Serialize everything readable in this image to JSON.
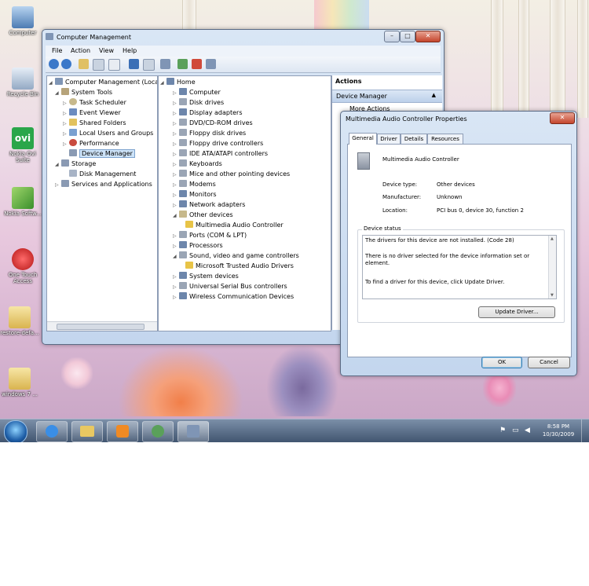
{
  "desktop": {
    "icons": [
      {
        "label": "Computer"
      },
      {
        "label": "Recycle Bin"
      },
      {
        "label": "Nokia Ovi Suite"
      },
      {
        "label": "Nokia Softw..."
      },
      {
        "label": "One Touch Access"
      },
      {
        "label": "restore-defa..."
      },
      {
        "label": "windows 7 ..."
      }
    ],
    "ovi_logo_text": "ovi"
  },
  "mgmt_window": {
    "title": "Computer Management",
    "menu": [
      "File",
      "Action",
      "View",
      "Help"
    ],
    "tree": [
      {
        "label": "Computer Management (Local"
      },
      {
        "label": "System Tools"
      },
      {
        "label": "Task Scheduler"
      },
      {
        "label": "Event Viewer"
      },
      {
        "label": "Shared Folders"
      },
      {
        "label": "Local Users and Groups"
      },
      {
        "label": "Performance"
      },
      {
        "label": "Device Manager"
      },
      {
        "label": "Storage"
      },
      {
        "label": "Disk Management"
      },
      {
        "label": "Services and Applications"
      }
    ],
    "devices": [
      {
        "label": "Home"
      },
      {
        "label": "Computer"
      },
      {
        "label": "Disk drives"
      },
      {
        "label": "Display adapters"
      },
      {
        "label": "DVD/CD-ROM drives"
      },
      {
        "label": "Floppy disk drives"
      },
      {
        "label": "Floppy drive controllers"
      },
      {
        "label": "IDE ATA/ATAPI controllers"
      },
      {
        "label": "Keyboards"
      },
      {
        "label": "Mice and other pointing devices"
      },
      {
        "label": "Modems"
      },
      {
        "label": "Monitors"
      },
      {
        "label": "Network adapters"
      },
      {
        "label": "Other devices"
      },
      {
        "label": "Multimedia Audio Controller"
      },
      {
        "label": "Ports (COM & LPT)"
      },
      {
        "label": "Processors"
      },
      {
        "label": "Sound, video and game controllers"
      },
      {
        "label": "Microsoft Trusted Audio Drivers"
      },
      {
        "label": "System devices"
      },
      {
        "label": "Universal Serial Bus controllers"
      },
      {
        "label": "Wireless Communication Devices"
      }
    ],
    "actions": {
      "header": "Actions",
      "section": "Device Manager",
      "more": "More Actions"
    }
  },
  "dialog": {
    "title": "Multimedia Audio Controller Properties",
    "tabs": [
      "General",
      "Driver",
      "Details",
      "Resources"
    ],
    "device_name": "Multimedia Audio Controller",
    "props": [
      {
        "label": "Device type:",
        "value": "Other devices"
      },
      {
        "label": "Manufacturer:",
        "value": "Unknown"
      },
      {
        "label": "Location:",
        "value": "PCI bus 0, device 30, function 2"
      }
    ],
    "status_group": "Device status",
    "status_lines": [
      "The drivers for this device are not installed. (Code 28)",
      "There is no driver selected for the device information set or",
      "element.",
      "To find a driver for this device, click Update Driver."
    ],
    "update_button": "Update Driver...",
    "ok": "OK",
    "cancel": "Cancel"
  },
  "taskbar": {
    "time": "8:58 PM",
    "date": "10/30/2009"
  }
}
